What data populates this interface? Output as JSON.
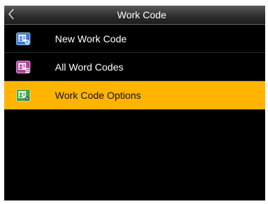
{
  "title_bar": {
    "title": "Work Code",
    "back_icon": "back-arrow-icon"
  },
  "menu": {
    "items": [
      {
        "label": "New Work Code",
        "icon": "new-work-code-icon",
        "icon_color": "#3a78d0",
        "selected": false
      },
      {
        "label": "All Word Codes",
        "icon": "all-work-codes-icon",
        "icon_color": "#b0409a",
        "selected": false
      },
      {
        "label": "Work Code Options",
        "icon": "work-code-options-icon",
        "icon_color": "#4aa04a",
        "selected": true
      }
    ]
  },
  "colors": {
    "screen_background": "#000000",
    "selection_highlight": "#ffb400",
    "text": "#ffffff"
  }
}
